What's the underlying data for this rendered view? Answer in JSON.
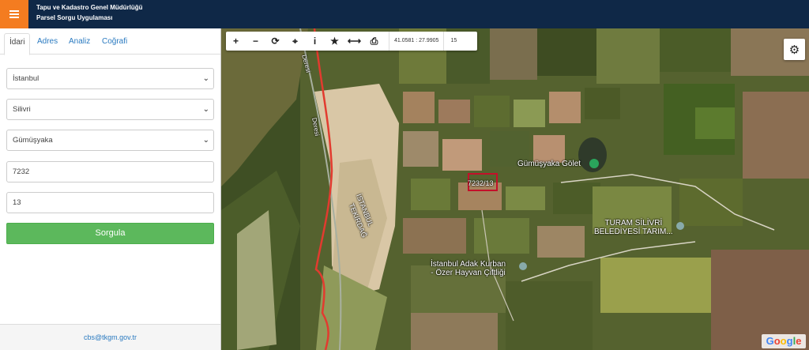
{
  "header": {
    "title_line1": "Tapu ve Kadastro Genel Müdürlüğü",
    "title_line2": "Parsel Sorgu Uygulaması",
    "menu_icon": "hamburger-icon",
    "brand_color": "#0f2847",
    "accent_color": "#f47c20"
  },
  "tabs": [
    "İdari",
    "Adres",
    "Analiz",
    "Coğrafi"
  ],
  "form": {
    "province": "İstanbul",
    "district": "Silivri",
    "neighborhood": "Gümüşyaka",
    "block": "7232",
    "parcel": "13",
    "submit_label": "Sorgula",
    "submit_color": "#5cb85c"
  },
  "footer": {
    "email": "cbs@tkgm.gov.tr"
  },
  "map": {
    "coords": "41.0581 : 27.9905",
    "zoom": "15",
    "parcel_label": "7232/13",
    "labels": {
      "pond": "Gümüşyaka Gölet",
      "turam_line1": "TURAM SİLİVRİ",
      "turam_line2": "BELEDİYESİ TARIM...",
      "farm_line1": "İstanbul Adak Kurban",
      "farm_line2": "- Özer Hayvan Çiftliği",
      "stream_a": "Deresi",
      "stream_b": "Deresi",
      "province_a": "İSTANBUL",
      "province_b": "TEKİRDAĞ"
    },
    "attribution": "Google"
  }
}
